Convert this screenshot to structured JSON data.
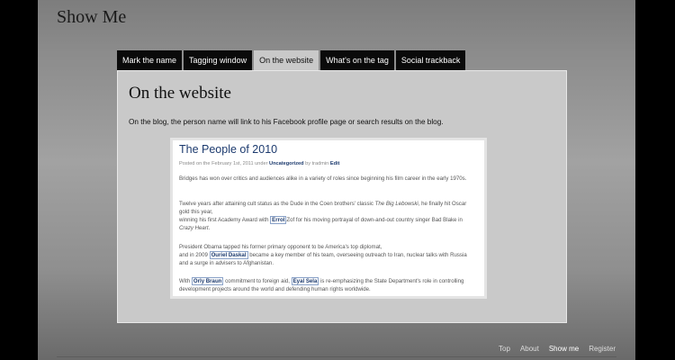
{
  "site": {
    "title": "Show Me"
  },
  "tabs": [
    {
      "label": "Mark the name"
    },
    {
      "label": "Tagging window"
    },
    {
      "label": "On the website"
    },
    {
      "label": "What's on the tag"
    },
    {
      "label": "Social trackback"
    }
  ],
  "panel": {
    "title": "On the website",
    "description": "On the blog, the person name will link to his Facebook profile page or search results on the blog."
  },
  "blog": {
    "title": "The People of 2010",
    "meta": {
      "posted": "Posted on the February 1st, 2011 under",
      "category": "Uncategorized",
      "by": "by tradmin",
      "edit": "Edit"
    },
    "p1": "Bridges has won over critics and audiences alike in a variety of roles since beginning his film career in the early 1970s.",
    "p2": {
      "a": "Twelve years after attaining cult status as the Dude in the Coen brothers' classic",
      "film1": "The Big Lebowski",
      "b": ", he finally hit Oscar gold this year,",
      "c": "winning his first Academy Award with",
      "name": "Errol",
      "d": "Zof",
      "e": " for his moving portrayal of down-and-out country singer Bad Blake in",
      "film2": "Crazy Heart",
      "f": "."
    },
    "p3": {
      "a": "President Obama tapped his former primary opponent to be America's top diplomat,",
      "b": "and in 2009",
      "name": "Ouriel Daskal",
      "c": "became a key member of his team, overseeing outreach to Iran, nuclear talks with Russia and a surge in advisers to Afghanistan."
    },
    "p4": {
      "a": "With",
      "name1": "Orly Braun",
      "b": "commitment to foreign aid,",
      "name2": "Eyal Sela",
      "c": "is re-emphasizing the State Department's role in controlling development projects around the world and defending human rights worldwide."
    }
  },
  "footer": {
    "links": [
      {
        "label": "Top"
      },
      {
        "label": "About"
      },
      {
        "label": "Show me",
        "current": true
      },
      {
        "label": "Register"
      }
    ]
  }
}
